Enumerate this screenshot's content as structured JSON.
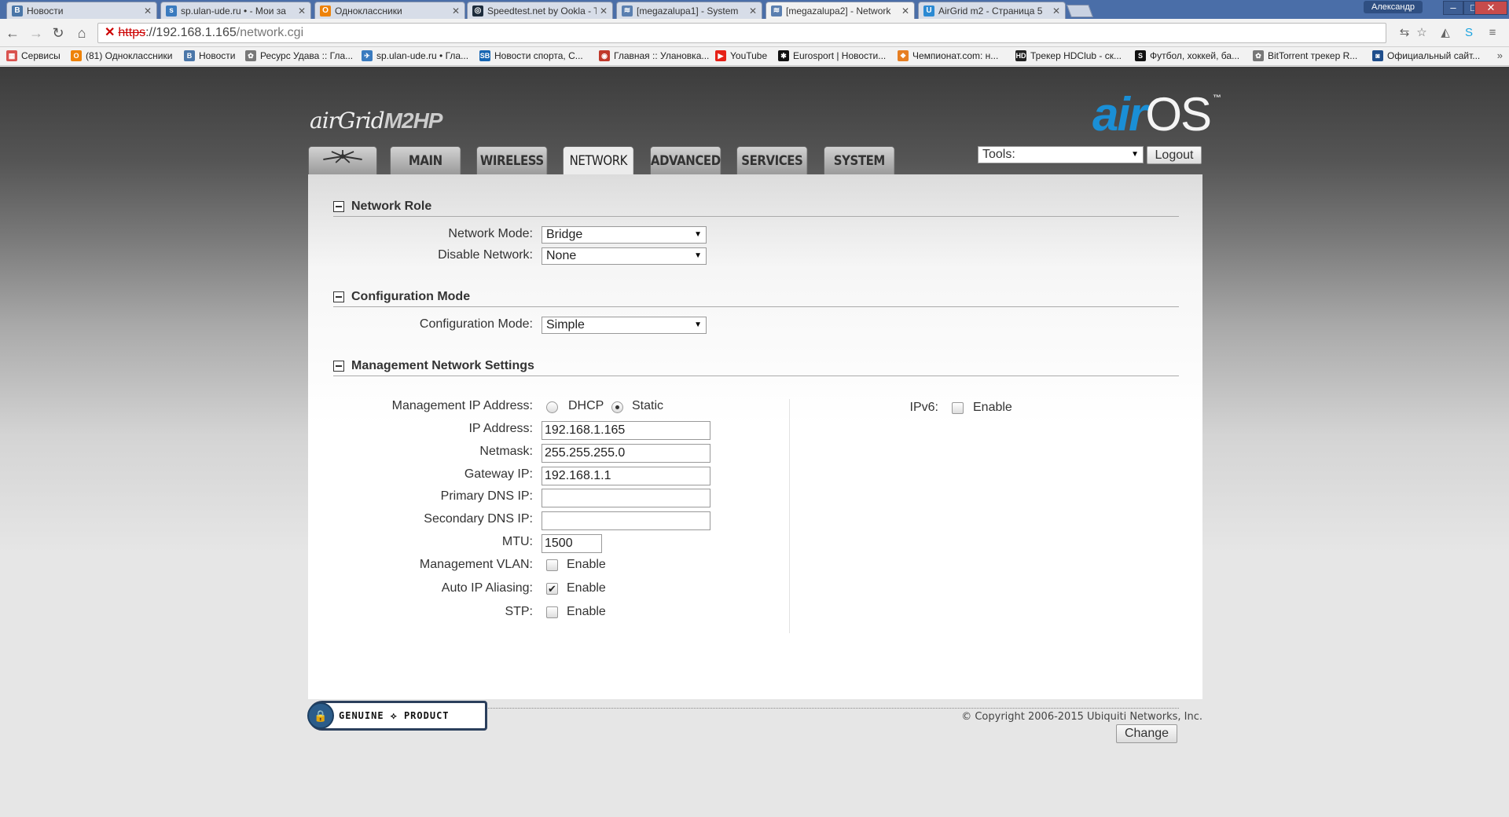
{
  "browser": {
    "tabs": [
      {
        "label": "Новости",
        "icon": "vk-icon",
        "color": "#4a76a8",
        "glyph": "В"
      },
      {
        "label": "sp.ulan-ude.ru • - Мои за",
        "icon": "sp-icon",
        "color": "#3a7bbf",
        "glyph": "s"
      },
      {
        "label": "Одноклассники",
        "icon": "ok-icon",
        "color": "#ee8208",
        "glyph": "О"
      },
      {
        "label": "Speedtest.net by Ookla - T",
        "icon": "speedtest-icon",
        "color": "#1d2c3c",
        "glyph": "◎"
      },
      {
        "label": "[megazalupa1] - System",
        "icon": "rss-icon",
        "color": "#5a7fb0",
        "glyph": "≋"
      },
      {
        "label": "[megazalupa2] - Network",
        "icon": "rss-icon",
        "color": "#5a7fb0",
        "glyph": "≋"
      },
      {
        "label": "AirGrid m2 - Страница 5",
        "icon": "ubnt-icon",
        "color": "#2b8ad3",
        "glyph": "U"
      }
    ],
    "active_tab": 5,
    "user": "Александр",
    "url_scheme": "https",
    "url_host": "://192.168.1.165",
    "url_path": "/network.cgi",
    "bookmarks": [
      {
        "label": "Сервисы",
        "color": "#d9534f",
        "glyph": "▦"
      },
      {
        "label": "(81) Одноклассники",
        "color": "#ee8208",
        "glyph": "О"
      },
      {
        "label": "Новости",
        "color": "#4a76a8",
        "glyph": "В"
      },
      {
        "label": "Ресурс Удава :: Гла...",
        "color": "#777777",
        "glyph": "✿"
      },
      {
        "label": "sp.ulan-ude.ru • Гла...",
        "color": "#3a7bbf",
        "glyph": "✈"
      },
      {
        "label": "Новости спорта, С...",
        "color": "#1766b3",
        "glyph": "SB"
      },
      {
        "label": "Главная :: Улановка...",
        "color": "#c0392b",
        "glyph": "◉"
      },
      {
        "label": "YouTube",
        "color": "#e62117",
        "glyph": "▶"
      },
      {
        "label": "Eurosport | Новости...",
        "color": "#111111",
        "glyph": "✱"
      },
      {
        "label": "Чемпионат.com: н...",
        "color": "#e67e22",
        "glyph": "❖"
      },
      {
        "label": "Трекер HDClub - ск...",
        "color": "#222222",
        "glyph": "HD"
      },
      {
        "label": "Футбол, хоккей, ба...",
        "color": "#111111",
        "glyph": "S"
      },
      {
        "label": "BitTorrent трекер R...",
        "color": "#777777",
        "glyph": "✿"
      },
      {
        "label": "Официальный сайт...",
        "color": "#1f4e8c",
        "glyph": "◙"
      }
    ]
  },
  "brand": {
    "product_script": "airGrid",
    "product_model": "M2HP",
    "os_air": "air",
    "os_name": "OS",
    "os_tm": "™"
  },
  "nav": {
    "tabs": [
      "MAIN",
      "WIRELESS",
      "NETWORK",
      "ADVANCED",
      "SERVICES",
      "SYSTEM"
    ],
    "active": "NETWORK",
    "tools_value": "Tools:",
    "logout_label": "Logout"
  },
  "network_role": {
    "title": "Network Role",
    "network_mode_label": "Network Mode:",
    "network_mode_value": "Bridge",
    "disable_network_label": "Disable Network:",
    "disable_network_value": "None"
  },
  "configuration_mode": {
    "title": "Configuration Mode",
    "label": "Configuration Mode:",
    "value": "Simple"
  },
  "management": {
    "title": "Management Network Settings",
    "mgmt_ip_label": "Management IP Address:",
    "dhcp_label": "DHCP",
    "static_label": "Static",
    "selected": "Static",
    "ip_label": "IP Address:",
    "ip_value": "192.168.1.165",
    "netmask_label": "Netmask:",
    "netmask_value": "255.255.255.0",
    "gateway_label": "Gateway IP:",
    "gateway_value": "192.168.1.1",
    "dns1_label": "Primary DNS IP:",
    "dns1_value": "",
    "dns2_label": "Secondary DNS IP:",
    "dns2_value": "",
    "mtu_label": "MTU:",
    "mtu_value": "1500",
    "vlan_label": "Management VLAN:",
    "vlan_option": "Enable",
    "vlan_checked": false,
    "aliasing_label": "Auto IP Aliasing:",
    "aliasing_option": "Enable",
    "aliasing_checked": true,
    "stp_label": "STP:",
    "stp_option": "Enable",
    "stp_checked": false,
    "ipv6_label": "IPv6:",
    "ipv6_option": "Enable",
    "ipv6_checked": false
  },
  "actions": {
    "change_label": "Change"
  },
  "footer": {
    "badge_text": "GENUINE ⟡ PRODUCT",
    "copyright": "© Copyright 2006-2015 Ubiquiti Networks, Inc."
  }
}
